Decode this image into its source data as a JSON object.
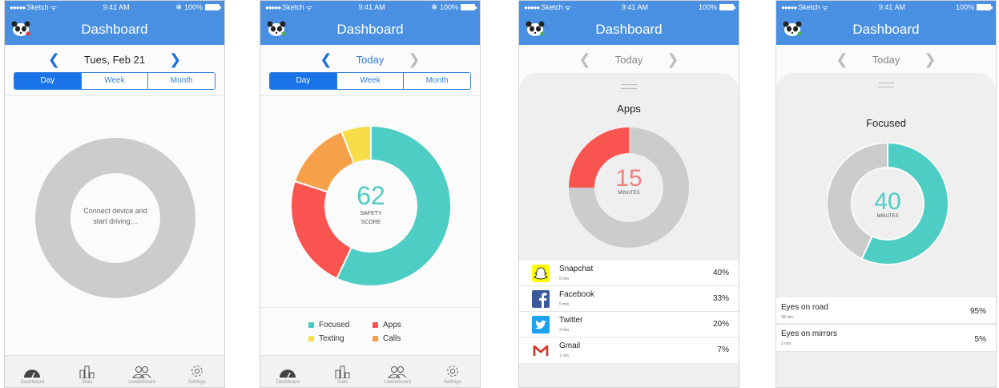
{
  "colors": {
    "brand": "#4a90e2",
    "focused": "#4ecdc4",
    "apps": "#fa5450",
    "texting": "#f8dd4a",
    "calls": "#f7a04a",
    "empty_ring": "#cccccc",
    "accent_text": "#f08080"
  },
  "status": {
    "carrier": "Sketch",
    "time": "9:41 AM",
    "battery": "100%"
  },
  "screen1": {
    "title": "Dashboard",
    "date": "Tues, Feb 21",
    "segments": [
      "Day",
      "Week",
      "Month"
    ],
    "ring_text_line1": "Connect device and",
    "ring_text_line2": "start driving…"
  },
  "screen2": {
    "title": "Dashboard",
    "date": "Today",
    "segments": [
      "Day",
      "Week",
      "Month"
    ],
    "score": "62",
    "score_label1": "SAFETY",
    "score_label2": "SCORE",
    "donut_values": {
      "focused": 57,
      "apps": 23,
      "calls": 14,
      "texting": 6
    },
    "legend": [
      {
        "label": "Focused",
        "color": "#4ecdc4"
      },
      {
        "label": "Apps",
        "color": "#fa5450"
      },
      {
        "label": "Texting",
        "color": "#f8dd4a"
      },
      {
        "label": "Calls",
        "color": "#f7a04a"
      }
    ]
  },
  "screen3": {
    "title": "Dashboard",
    "date": "Today",
    "sheet_title": "Apps",
    "center_value": "15",
    "center_unit": "MINUTES",
    "apps_fraction": 0.25,
    "rows": [
      {
        "name": "Snapchat",
        "sub": "6 min",
        "pct": "40%",
        "icon": "snapchat-icon"
      },
      {
        "name": "Facebook",
        "sub": "5 min",
        "pct": "33%",
        "icon": "facebook-icon"
      },
      {
        "name": "Twitter",
        "sub": "3 min",
        "pct": "20%",
        "icon": "twitter-icon"
      },
      {
        "name": "Gmail",
        "sub": "1 min",
        "pct": "7%",
        "icon": "gmail-icon"
      }
    ]
  },
  "screen4": {
    "title": "Dashboard",
    "date": "Today",
    "sheet_title": "Focused",
    "center_value": "40",
    "center_unit": "MINUTES",
    "focused_fraction": 0.57,
    "rows": [
      {
        "name": "Eyes on road",
        "sub": "38 min",
        "pct": "95%"
      },
      {
        "name": "Eyes on mirrors",
        "sub": "2 min",
        "pct": "5%"
      }
    ]
  },
  "tabs": [
    "Dashboard",
    "Stats",
    "Leaderboard",
    "Settings"
  ]
}
